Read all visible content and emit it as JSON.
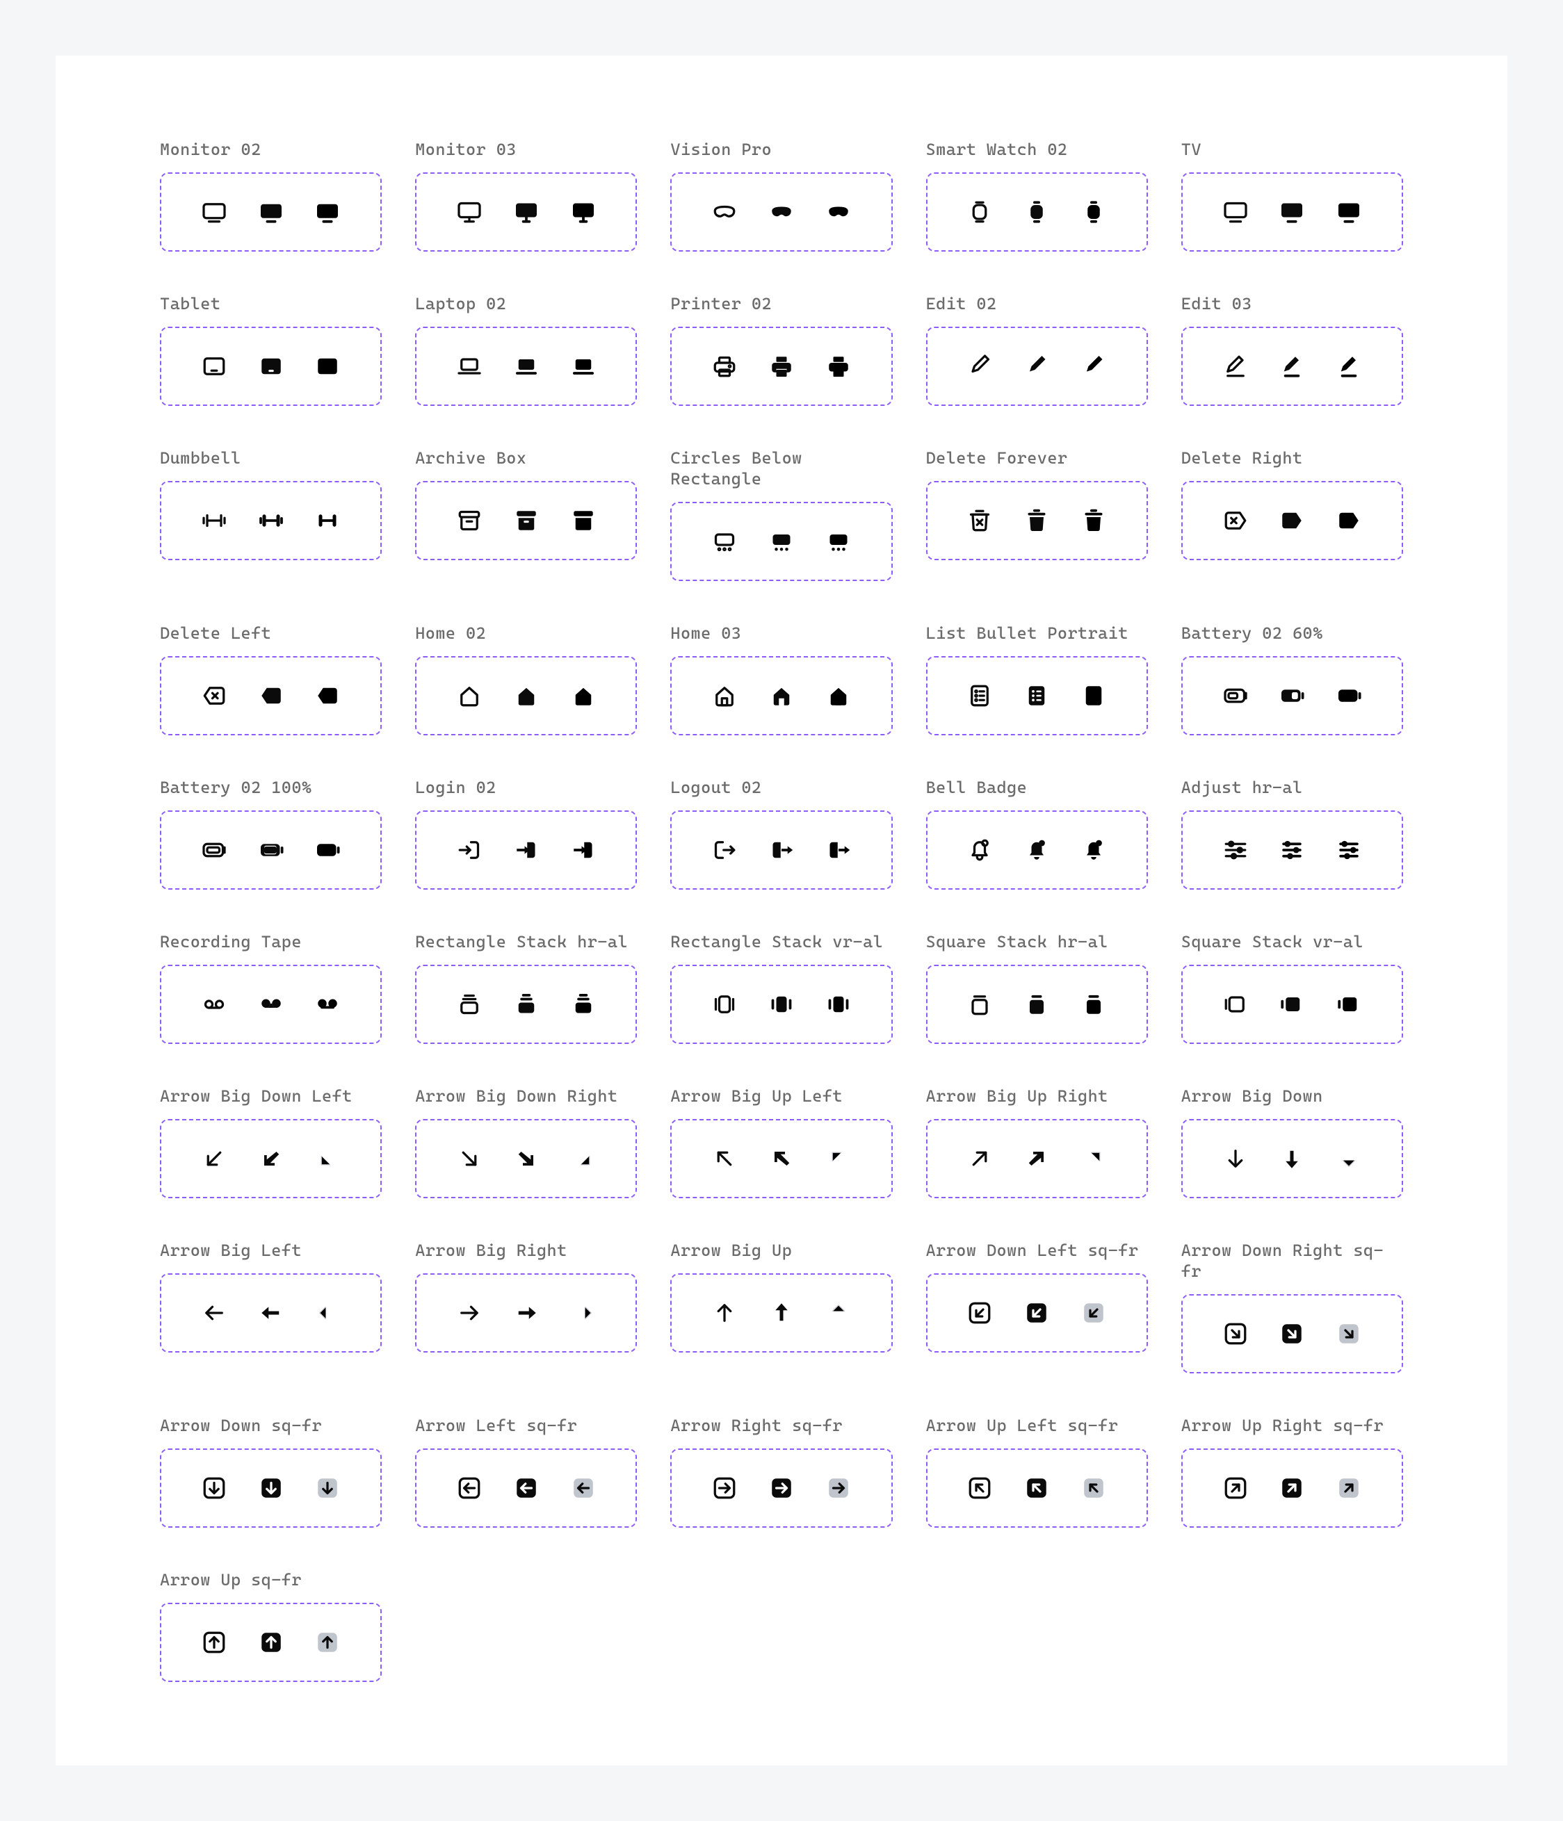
{
  "icons": [
    {
      "name": "Monitor 02"
    },
    {
      "name": "Monitor 03"
    },
    {
      "name": "Vision Pro"
    },
    {
      "name": "Smart Watch 02"
    },
    {
      "name": "TV"
    },
    {
      "name": "Tablet"
    },
    {
      "name": "Laptop 02"
    },
    {
      "name": "Printer 02"
    },
    {
      "name": "Edit 02"
    },
    {
      "name": "Edit 03"
    },
    {
      "name": "Dumbbell"
    },
    {
      "name": "Archive Box"
    },
    {
      "name": "Circles Below Rectangle"
    },
    {
      "name": "Delete Forever"
    },
    {
      "name": "Delete Right"
    },
    {
      "name": "Delete Left"
    },
    {
      "name": "Home 02"
    },
    {
      "name": "Home 03"
    },
    {
      "name": "List Bullet Portrait"
    },
    {
      "name": "Battery 02 60%"
    },
    {
      "name": "Battery 02 100%"
    },
    {
      "name": "Login 02"
    },
    {
      "name": "Logout 02"
    },
    {
      "name": "Bell Badge"
    },
    {
      "name": "Adjust hr-al"
    },
    {
      "name": "Recording Tape"
    },
    {
      "name": "Rectangle Stack hr-al"
    },
    {
      "name": "Rectangle Stack vr-al"
    },
    {
      "name": "Square Stack hr-al"
    },
    {
      "name": "Square Stack vr-al"
    },
    {
      "name": "Arrow Big Down Left"
    },
    {
      "name": "Arrow Big Down Right"
    },
    {
      "name": "Arrow Big Up Left"
    },
    {
      "name": "Arrow Big Up Right"
    },
    {
      "name": "Arrow Big Down"
    },
    {
      "name": "Arrow Big Left"
    },
    {
      "name": "Arrow Big Right"
    },
    {
      "name": "Arrow Big Up"
    },
    {
      "name": "Arrow Down Left sq-fr"
    },
    {
      "name": "Arrow Down Right sq-fr"
    },
    {
      "name": "Arrow Down sq-fr"
    },
    {
      "name": "Arrow Left sq-fr"
    },
    {
      "name": "Arrow Right sq-fr"
    },
    {
      "name": "Arrow Up Left sq-fr"
    },
    {
      "name": "Arrow Up Right sq-fr"
    },
    {
      "name": "Arrow Up sq-fr"
    }
  ],
  "variants": [
    "outline",
    "solid",
    "duo"
  ]
}
